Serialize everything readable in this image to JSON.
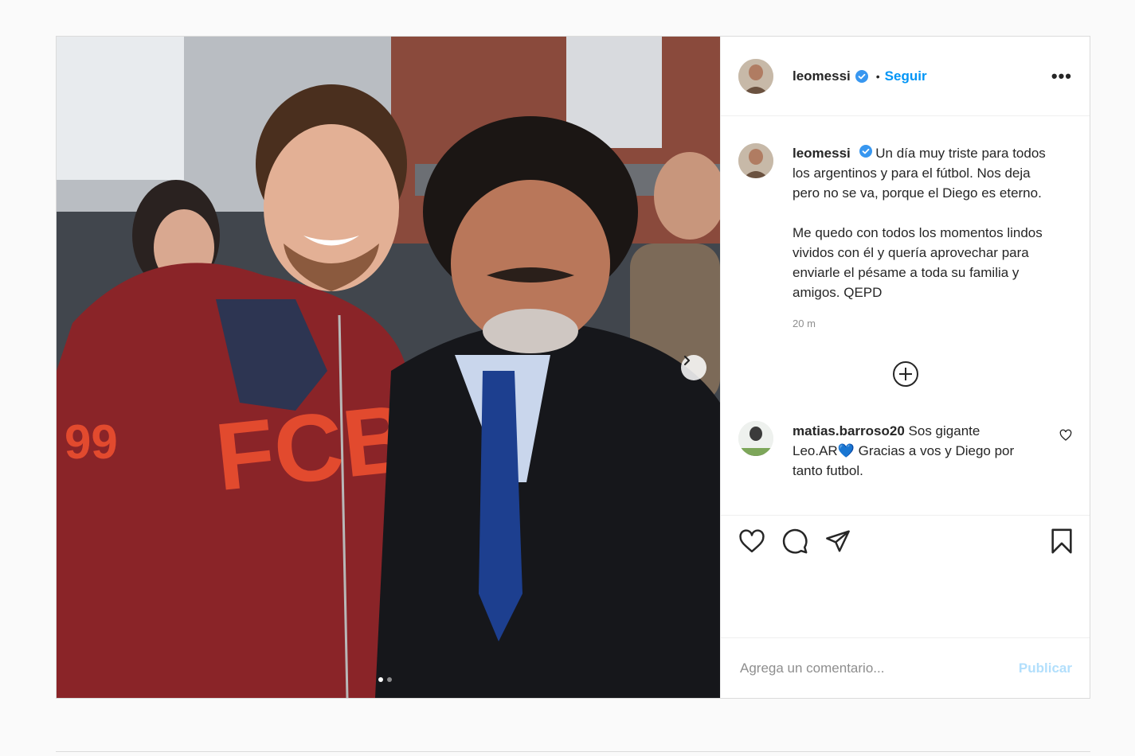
{
  "post": {
    "username": "leomessi",
    "follow_label": "Seguir",
    "bullet": "•",
    "more_label": "•••",
    "caption_paragraphs": [
      "Un día muy triste para todos los argentinos y para el fútbol. Nos deja pero no se va, porque el Diego es eterno.",
      "Me quedo con todos los momentos lindos vividos con él y quería aprovechar para enviarle el pésame a toda su familia y amigos. QEPD"
    ],
    "timestamp": "20 m",
    "carousel": {
      "slide_count": 2,
      "current_slide": 1
    }
  },
  "comments": [
    {
      "username": "matias.barroso20",
      "text": "Sos gigante Leo.AR💙 Gracias a vos y Diego por tanto futbol."
    }
  ],
  "add_comment": {
    "placeholder": "Agrega un comentario...",
    "publish_label": "Publicar"
  },
  "icons": {
    "verified": "verified-badge-icon",
    "next": "chevron-right-icon",
    "load_more": "plus-circle-icon",
    "like": "heart-icon",
    "comment": "comment-bubble-icon",
    "share": "paper-plane-icon",
    "save": "bookmark-icon"
  },
  "colors": {
    "accent": "#0095f6",
    "publish_disabled": "#b2dffc",
    "verified": "#3897f0",
    "text": "#262626",
    "muted": "#8e8e8e",
    "border": "#dbdbdb"
  }
}
